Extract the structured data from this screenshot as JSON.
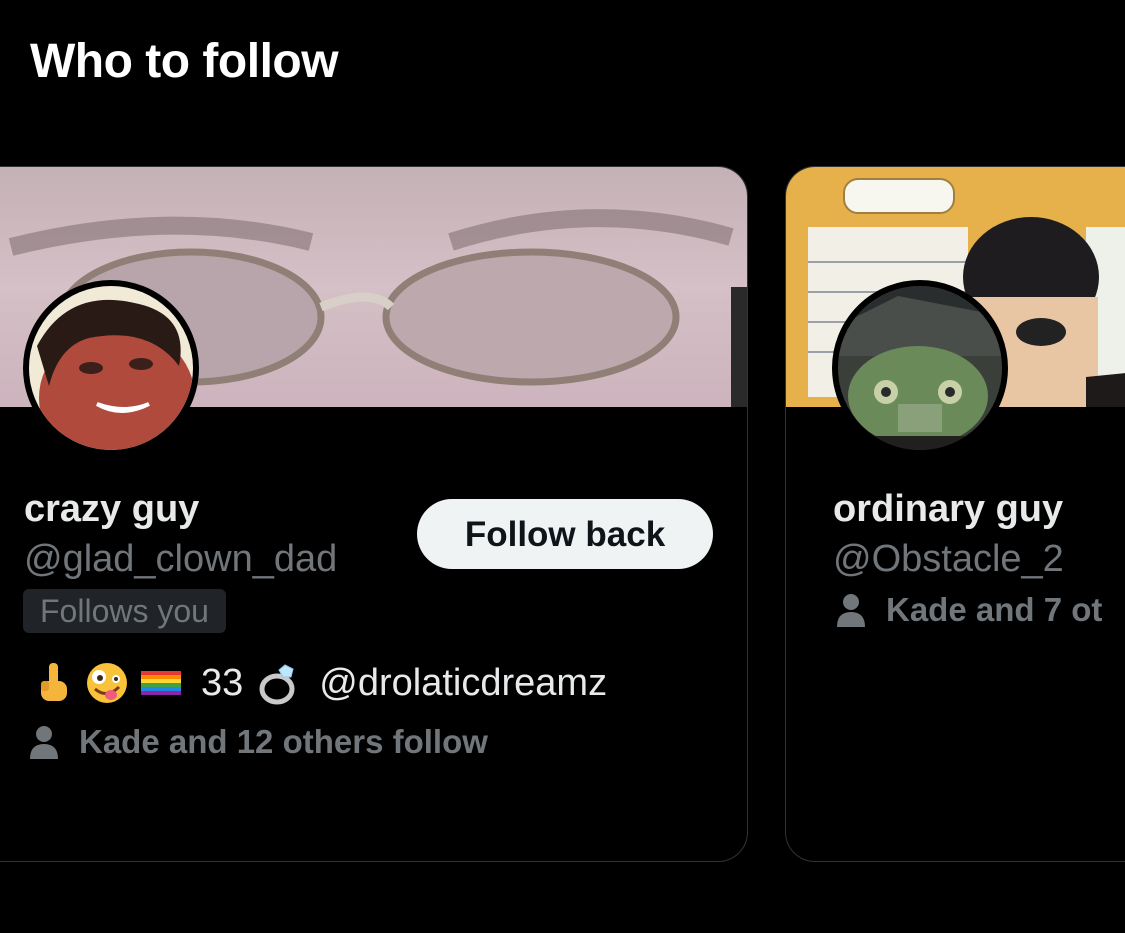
{
  "section": {
    "title": "Who to follow"
  },
  "cards": [
    {
      "display_name": "crazy guy",
      "handle": "@glad_clown_dad",
      "follows_you_badge": "Follows you",
      "follow_button_label": "Follow back",
      "bio": {
        "emojis": [
          "middle-finger-emoji",
          "zany-face-emoji",
          "rainbow-flag-emoji"
        ],
        "number": "33",
        "ring_emoji": "ring-emoji",
        "mention": "@drolaticdreamz"
      },
      "mutuals_text": "Kade and 12 others follow"
    },
    {
      "display_name": "ordinary guy",
      "handle": "@Obstacle_2",
      "mutuals_text": "Kade and 7 ot"
    }
  ],
  "colors": {
    "background": "#000000",
    "card_border": "#2f3336",
    "primary_text": "#e7e9ea",
    "secondary_text": "#71767b",
    "button_bg": "#eff3f4",
    "button_text": "#0f1419",
    "badge_bg": "#202327"
  }
}
